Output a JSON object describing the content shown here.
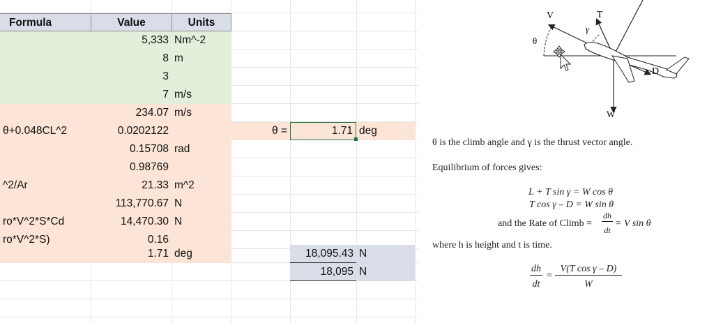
{
  "sheet": {
    "headers": {
      "formula": "Formula",
      "value": "Value",
      "units": "Units"
    },
    "rows": [
      {
        "formula": "",
        "value": "5,333",
        "units": "Nm^-2"
      },
      {
        "formula": "",
        "value": "8",
        "units": "m"
      },
      {
        "formula": "",
        "value": "3",
        "units": ""
      },
      {
        "formula": "",
        "value": "7",
        "units": "m/s"
      },
      {
        "formula": "",
        "value": "234.07",
        "units": "m/s"
      },
      {
        "formula": "θ+0.048CL^2",
        "value": "0.0202122",
        "units": ""
      },
      {
        "formula": "",
        "value": "0.15708",
        "units": "rad"
      },
      {
        "formula": "",
        "value": "0.98769",
        "units": ""
      },
      {
        "formula": "^2/Ar",
        "value": "21.33",
        "units": "m^2"
      },
      {
        "formula": "",
        "value": "113,770.67",
        "units": "N"
      },
      {
        "formula": "ro*V^2*S*Cd",
        "value": "14,470.30",
        "units": "N"
      },
      {
        "formula": "ro*V^2*S)",
        "value": "0.16",
        "units": ""
      },
      {
        "formula": "",
        "value": "1.71",
        "units": "deg"
      }
    ],
    "theta": {
      "label": "θ =",
      "value": "1.71",
      "units": "deg"
    },
    "results": [
      {
        "value": "18,095.43",
        "units": "N"
      },
      {
        "value": "18,095",
        "units": "N"
      }
    ],
    "colors": {
      "green": "#e2efda",
      "peach": "#fce4d6",
      "header": "#d9dde8",
      "selected": "#217346"
    }
  },
  "figure": {
    "labels": {
      "v": "V",
      "t": "T",
      "gamma": "γ",
      "theta": "θ",
      "d": "D",
      "w": "W"
    }
  },
  "text": {
    "line1": "θ is the climb angle and γ is the thrust vector angle.",
    "line2": "Equilibrium of forces gives:",
    "eq1": "L + T sin γ = W cos θ",
    "eq2": "T cos γ – D = W sin θ",
    "eq3_prefix": "and the Rate of Climb =",
    "eq3_num": "dh",
    "eq3_den": "dt",
    "eq3_suffix": "= V sin θ",
    "line3": "where h is height and t is time.",
    "eq4_num": "dh",
    "eq4_den": "dt",
    "eq4_rhs_num": "V(T cos γ – D)",
    "eq4_rhs_den": "W"
  }
}
